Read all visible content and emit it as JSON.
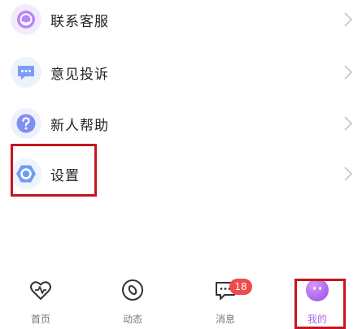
{
  "menu": {
    "items": [
      {
        "label": "联系客服",
        "icon": "customer-service-icon",
        "icon_color": "#b986f4"
      },
      {
        "label": "意见投诉",
        "icon": "feedback-chat-icon",
        "icon_color": "#7d9cf5"
      },
      {
        "label": "新人帮助",
        "icon": "question-help-icon",
        "icon_color": "#7d8ff0"
      },
      {
        "label": "设置",
        "icon": "settings-hex-icon",
        "icon_color": "#6f9cf5"
      }
    ]
  },
  "tabbar": {
    "tabs": [
      {
        "label": "首页",
        "icon": "home-heartbeat-icon"
      },
      {
        "label": "动态",
        "icon": "compass-icon"
      },
      {
        "label": "消息",
        "icon": "message-icon",
        "badge": "18"
      },
      {
        "label": "我的",
        "icon": "profile-avatar-icon",
        "active": true
      }
    ]
  },
  "colors": {
    "highlight": "#c8141e",
    "accent": "#b068e8",
    "badge": "#ef4b4b",
    "tab_text": "#777777",
    "text": "#222222"
  }
}
